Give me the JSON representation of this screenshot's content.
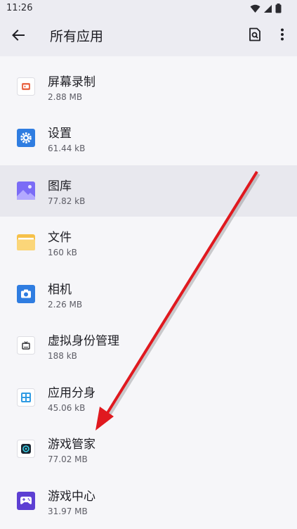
{
  "status_bar": {
    "time": "11:26",
    "icons": [
      "wifi-icon",
      "signal-icon",
      "battery-icon"
    ]
  },
  "app_bar": {
    "title": "所有应用",
    "back_icon": "back-arrow-icon",
    "search_icon": "search-icon",
    "more_icon": "more-vert-icon"
  },
  "apps": [
    {
      "name": "屏幕录制",
      "size": "2.88 MB",
      "icon": "screen-record-icon",
      "highlighted": false
    },
    {
      "name": "设置",
      "size": "61.44 kB",
      "icon": "settings-icon",
      "highlighted": false
    },
    {
      "name": "图库",
      "size": "77.82 kB",
      "icon": "gallery-icon",
      "highlighted": true
    },
    {
      "name": "文件",
      "size": "160 kB",
      "icon": "files-icon",
      "highlighted": false
    },
    {
      "name": "相机",
      "size": "2.26 MB",
      "icon": "camera-icon",
      "highlighted": false
    },
    {
      "name": "虚拟身份管理",
      "size": "188 kB",
      "icon": "virtual-identity-icon",
      "highlighted": false
    },
    {
      "name": "应用分身",
      "size": "45.06 kB",
      "icon": "app-clone-icon",
      "highlighted": false
    },
    {
      "name": "游戏管家",
      "size": "77.02 MB",
      "icon": "game-manager-icon",
      "highlighted": false
    },
    {
      "name": "游戏中心",
      "size": "31.97 MB",
      "icon": "game-center-icon",
      "highlighted": false
    }
  ],
  "annotation": {
    "type": "arrow",
    "color": "#e0191f",
    "points_to": "游戏管家"
  },
  "colors": {
    "accent": "#e0191f",
    "settings_blue": "#2f7de1",
    "gallery_purple": "#7b6cf6",
    "files_yellow": "#f6c14a",
    "game_center_purple": "#5d3fd3"
  }
}
